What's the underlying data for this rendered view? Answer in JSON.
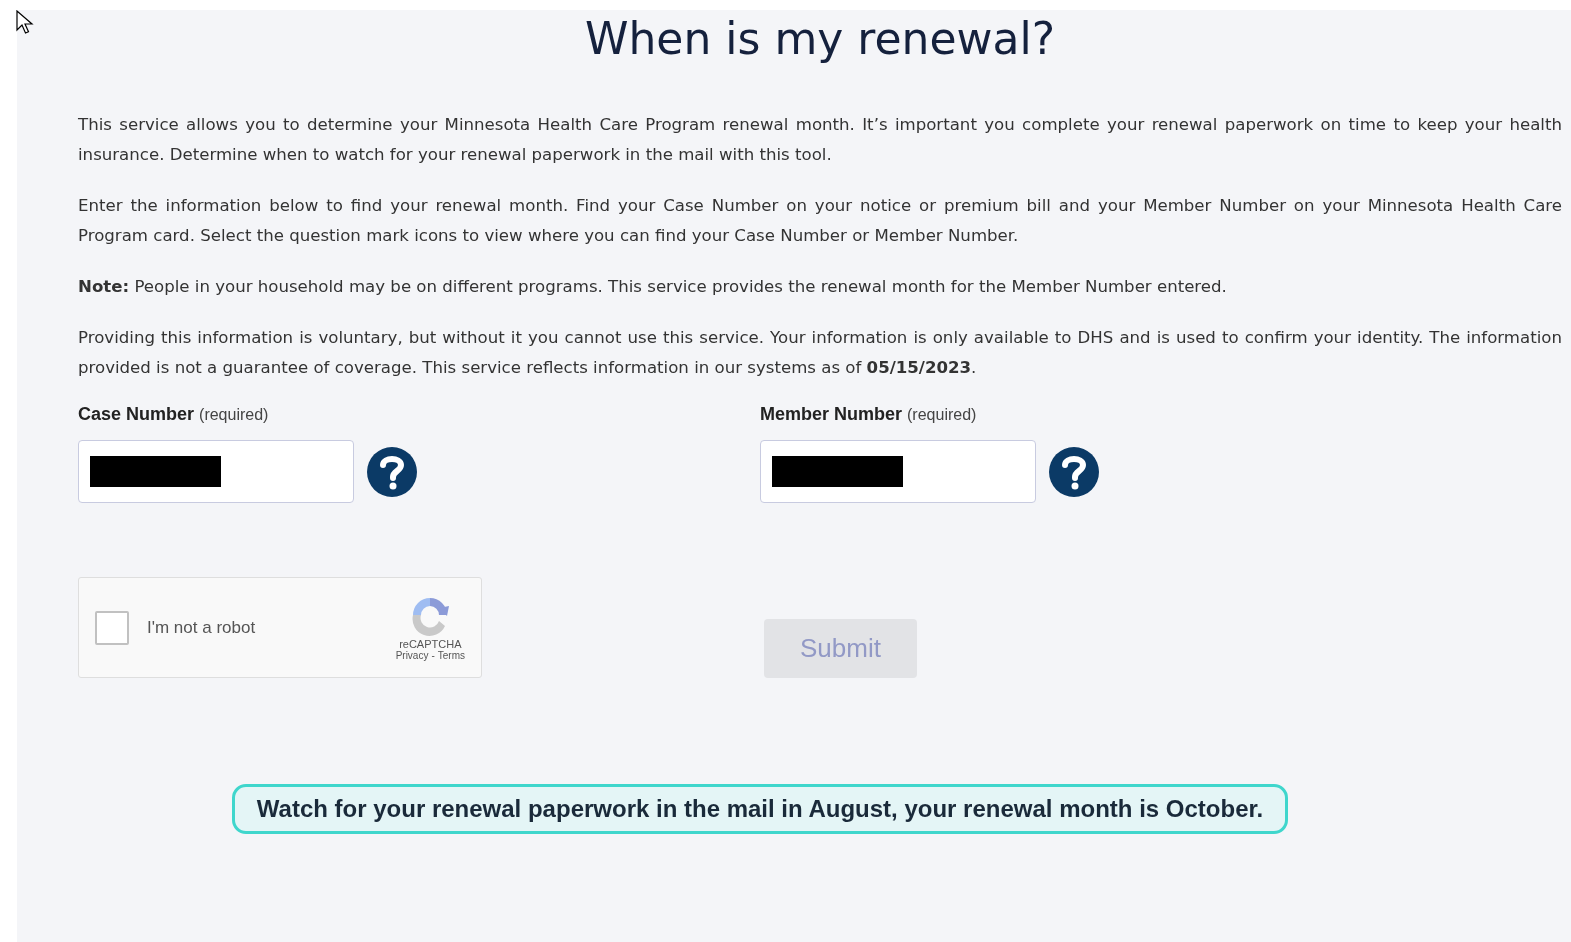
{
  "title": "When is my renewal?",
  "paragraphs": [
    "This service allows you to determine your Minnesota Health Care Program renewal month. It’s important you complete your renewal paperwork on time to keep your health insurance. Determine when to watch for your renewal paperwork in the mail with this tool.",
    "Enter the information below to find your renewal month. Find your Case Number on your notice or premium bill and your Member Number on your Minnesota Health Care Program card. Select the question mark icons to view where you can find your Case Number or Member Number.",
    "**Note:** People in your household may be on different programs. This service provides the renewal month for the Member Number entered.",
    "Providing this information is voluntary, but without it you cannot use this service. Your information is only available to DHS and is used to confirm your identity. The information provided is not a guarantee of coverage. This service reflects information in our systems as of **05/15/2023**."
  ],
  "fields": [
    {
      "label": "Case Number",
      "hint": "(required)",
      "redacted": true
    },
    {
      "label": "Member Number",
      "hint": "(required)",
      "redacted": true
    }
  ],
  "captcha": {
    "label": "I'm not a robot",
    "checked": false,
    "brand": "reCAPTCHA",
    "links": [
      "Privacy",
      "Terms"
    ],
    "separator": "-"
  },
  "submit": {
    "label": "Submit",
    "disabled": true
  },
  "result": "Watch for your renewal paperwork in the mail in August, your renewal month is October."
}
